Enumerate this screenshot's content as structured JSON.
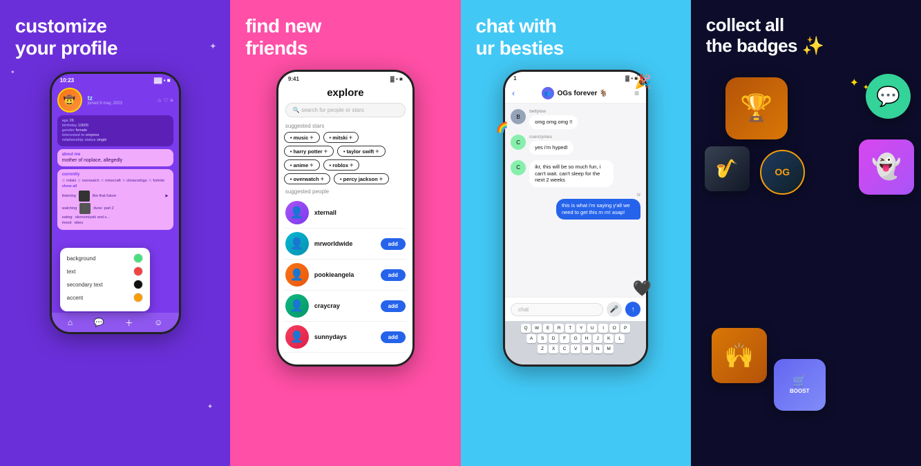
{
  "panels": [
    {
      "id": "panel-1",
      "title": "customize\nyour profile",
      "bg": "#6B2FD9",
      "phone": {
        "status_time": "10:23",
        "username": "tz",
        "joined": "joined 9 may, 2023",
        "age": "age 26",
        "birthday": "birthday 1/8/05",
        "gender": "gender female",
        "interested": "interested in empires",
        "relationship": "relationship status single",
        "about_label": "about me",
        "about_text": "mother of noplace, allegedly",
        "currently_label": "currently",
        "stars": [
          "mitski",
          "overwatch",
          "minecraft",
          "oliviarodrigo",
          "fortnite",
          "show all"
        ],
        "activity_rows": [
          {
            "label": "listening",
            "value": "like that future"
          },
          {
            "label": "watching",
            "value": "dune: part 2"
          },
          {
            "label": "eating",
            "value": "okonomiyaki and s..."
          },
          {
            "label": "mood",
            "value": "vibes"
          }
        ],
        "color_picker": {
          "items": [
            {
              "label": "background",
              "color": "#4ade80"
            },
            {
              "label": "text",
              "color": "#ef4444"
            },
            {
              "label": "secondary text",
              "color": "#111"
            },
            {
              "label": "accent",
              "color": "#f59e0b"
            }
          ]
        }
      }
    },
    {
      "id": "panel-2",
      "title": "find new\nfriends",
      "bg": "#FF4FA6",
      "phone": {
        "status_time": "9:41",
        "explore_title": "explore",
        "search_placeholder": "search for people or stars",
        "suggested_stars_label": "suggested stars",
        "tags": [
          "music",
          "mitski",
          "harry potter",
          "taylor swift",
          "anime",
          "roblox",
          "overwatch",
          "percy jackson"
        ],
        "suggested_people_label": "suggested people",
        "people": [
          {
            "name": "xternall",
            "has_add": false
          },
          {
            "name": "mrworldwide",
            "has_add": true
          },
          {
            "name": "pookieangela",
            "has_add": true
          },
          {
            "name": "craycray",
            "has_add": true
          },
          {
            "name": "sunnydays",
            "has_add": true
          }
        ],
        "add_label": "add"
      }
    },
    {
      "id": "panel-3",
      "title": "chat with\nur besties",
      "bg": "#42C8F5",
      "phone": {
        "status_time": "1",
        "chat_name": "OGs forever",
        "messages": [
          {
            "user": "bettylow",
            "text": "omg omg omg !!",
            "side": "left"
          },
          {
            "user": "coenzymes",
            "text": "yes i'm hyped!",
            "side": "left"
          },
          {
            "user": "",
            "text": "ikr, this will be so much fun, i can't wait. can't sleep for the next 2 weeks",
            "side": "left"
          },
          {
            "user": "tz",
            "text": "this is what i'm saying y'all we need to get this rn rn! asap!",
            "side": "right"
          }
        ],
        "chat_placeholder": "chat",
        "keyboard_rows": [
          [
            "Q",
            "W",
            "E",
            "R",
            "T",
            "Y",
            "U",
            "I",
            "O",
            "P"
          ],
          [
            "A",
            "S",
            "D",
            "F",
            "G",
            "H",
            "J",
            "K",
            "L"
          ],
          [
            "Z",
            "X",
            "C",
            "V",
            "B",
            "N",
            "M"
          ]
        ]
      }
    },
    {
      "id": "panel-4",
      "title": "collect all\nthe badges ✨",
      "bg": "#0D0D2B",
      "badges": [
        {
          "id": "trophy",
          "emoji": "🏆",
          "label": "trophy badge"
        },
        {
          "id": "chat",
          "emoji": "💬",
          "label": "chat badge"
        },
        {
          "id": "music",
          "emoji": "🎷",
          "label": "music badge"
        },
        {
          "id": "og",
          "text": "OG",
          "label": "og badge"
        },
        {
          "id": "purple-ghost",
          "emoji": "👻",
          "label": "ghost badge"
        },
        {
          "id": "hands",
          "emoji": "🙌",
          "label": "hands badge"
        },
        {
          "id": "boost",
          "text": "BOOST",
          "label": "boost badge"
        }
      ]
    }
  ]
}
